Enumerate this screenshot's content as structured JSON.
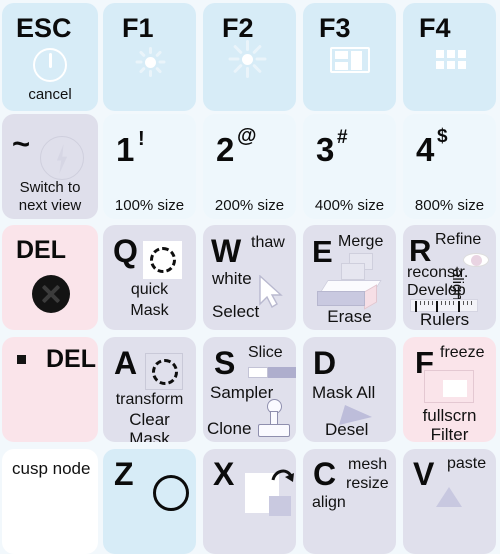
{
  "meta": {
    "title": "Keyboard shortcut sticker overlay",
    "background_color": "#f2f8fc"
  },
  "colors": {
    "blue": "#d7ecf7",
    "pale_blue": "#eef7fc",
    "lavender": "#dfdfeb",
    "pink": "#fae4ea",
    "white": "#ffffff",
    "text": "#111111"
  },
  "rows": [
    {
      "name": "function-row",
      "keys": [
        {
          "id": "esc",
          "glyph": "ESC",
          "theme": "blue",
          "icon": "power-icon",
          "labels": {
            "bottom": "cancel"
          }
        },
        {
          "id": "f1",
          "glyph": "F1",
          "theme": "blue",
          "icon": "brightness-down-icon",
          "labels": {}
        },
        {
          "id": "f2",
          "glyph": "F2",
          "theme": "blue",
          "icon": "brightness-up-icon",
          "labels": {}
        },
        {
          "id": "f3",
          "glyph": "F3",
          "theme": "blue",
          "icon": "mission-control-icon",
          "labels": {}
        },
        {
          "id": "f4",
          "glyph": "F4",
          "theme": "blue",
          "icon": "launchpad-grid-icon",
          "labels": {}
        }
      ]
    },
    {
      "name": "number-row",
      "keys": [
        {
          "id": "tilde",
          "glyph": "~",
          "theme": "lavender",
          "icon": "lightning-bolt-icon",
          "labels": {
            "line1": "Switch to",
            "line2": "next view"
          }
        },
        {
          "id": "one",
          "glyph": "1",
          "sup": "!",
          "theme": "pale_blue",
          "labels": {
            "bottom": "100% size"
          }
        },
        {
          "id": "two",
          "glyph": "2",
          "sup": "@",
          "theme": "pale_blue",
          "labels": {
            "bottom": "200% size"
          }
        },
        {
          "id": "three",
          "glyph": "3",
          "sup": "#",
          "theme": "pale_blue",
          "labels": {
            "bottom": "400% size"
          }
        },
        {
          "id": "four",
          "glyph": "4",
          "sup": "$",
          "theme": "pale_blue",
          "labels": {
            "bottom": "800% size"
          }
        }
      ]
    },
    {
      "name": "qwer-row",
      "keys": [
        {
          "id": "del-1",
          "glyph": "DEL",
          "theme": "pink",
          "icon": "delete-disc-icon",
          "labels": {}
        },
        {
          "id": "q",
          "glyph": "Q",
          "theme": "lavender",
          "icon": "dashed-circle-icon",
          "labels": {
            "line1": "quick",
            "line2": "Mask"
          }
        },
        {
          "id": "w",
          "glyph": "W",
          "theme": "lavender",
          "icon": "cursor-arrow-icon",
          "labels": {
            "top_right": "thaw",
            "mid": "white",
            "bottom": "Select"
          }
        },
        {
          "id": "e",
          "glyph": "E",
          "theme": "lavender",
          "icon": "eraser-icon",
          "labels": {
            "top_right": "Merge",
            "bottom": "Erase"
          }
        },
        {
          "id": "r",
          "glyph": "R",
          "theme": "lavender",
          "icon": "ruler-icon",
          "labels": {
            "top_right": "Refine",
            "line2": "reconstr.",
            "line3": "Develop",
            "rotated": "align",
            "bottom": "Rulers"
          }
        }
      ]
    },
    {
      "name": "asdf-row",
      "keys": [
        {
          "id": "del-2",
          "glyph": "DEL",
          "theme": "pink",
          "icon": "small-square-bullet-icon",
          "labels": {}
        },
        {
          "id": "a",
          "glyph": "A",
          "theme": "lavender",
          "icon": "dashed-circle-icon",
          "labels": {
            "line1": "transform",
            "line2": "Clear",
            "line3": "Mask"
          }
        },
        {
          "id": "s",
          "glyph": "S",
          "theme": "lavender",
          "icon": "clone-stamp-icon",
          "labels": {
            "top_right": "Slice",
            "mid": "Sampler",
            "bottom": "Clone"
          }
        },
        {
          "id": "d",
          "glyph": "D",
          "theme": "lavender",
          "icon": "deselect-arrow-icon",
          "labels": {
            "mid": "Mask All",
            "bottom": "Desel"
          }
        },
        {
          "id": "f",
          "glyph": "F",
          "theme": "pink",
          "icon": "fullscreen-frame-icon",
          "labels": {
            "top_right": "freeze",
            "line2": "fullscrn",
            "line3": "Filter"
          }
        }
      ]
    },
    {
      "name": "zxcv-row",
      "keys": [
        {
          "id": "cusp",
          "glyph": "",
          "theme": "white",
          "labels": {
            "top": "cusp node"
          }
        },
        {
          "id": "z",
          "glyph": "Z",
          "theme": "blue",
          "icon": "magnifier-icon",
          "labels": {}
        },
        {
          "id": "x",
          "glyph": "X",
          "theme": "lavender",
          "icon": "rotate-arrow-icon",
          "labels": {}
        },
        {
          "id": "c",
          "glyph": "C",
          "theme": "lavender",
          "labels": {
            "top_right": "mesh",
            "line2": "resize",
            "line3": "align"
          }
        },
        {
          "id": "v",
          "glyph": "V",
          "theme": "lavender",
          "icon": "paste-triangle-icon",
          "labels": {
            "top_right": "paste"
          }
        }
      ]
    }
  ]
}
